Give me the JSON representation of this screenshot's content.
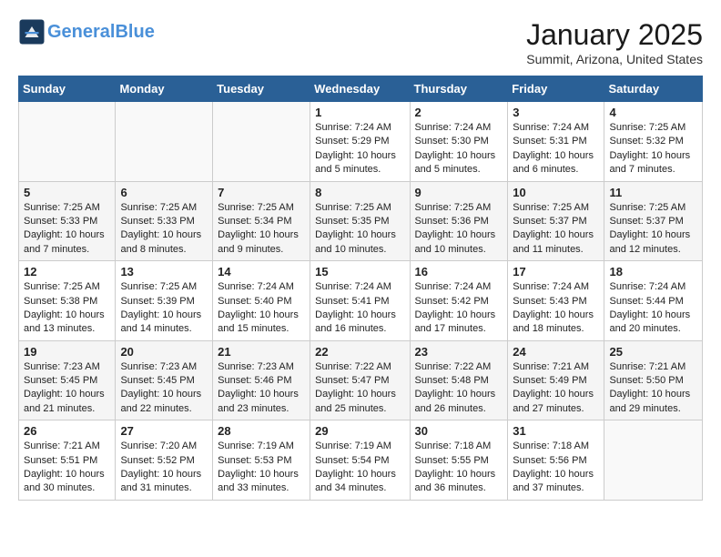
{
  "header": {
    "logo_line1": "General",
    "logo_line2": "Blue",
    "month": "January 2025",
    "location": "Summit, Arizona, United States"
  },
  "days_of_week": [
    "Sunday",
    "Monday",
    "Tuesday",
    "Wednesday",
    "Thursday",
    "Friday",
    "Saturday"
  ],
  "weeks": [
    [
      {
        "day": "",
        "content": ""
      },
      {
        "day": "",
        "content": ""
      },
      {
        "day": "",
        "content": ""
      },
      {
        "day": "1",
        "content": "Sunrise: 7:24 AM\nSunset: 5:29 PM\nDaylight: 10 hours\nand 5 minutes."
      },
      {
        "day": "2",
        "content": "Sunrise: 7:24 AM\nSunset: 5:30 PM\nDaylight: 10 hours\nand 5 minutes."
      },
      {
        "day": "3",
        "content": "Sunrise: 7:24 AM\nSunset: 5:31 PM\nDaylight: 10 hours\nand 6 minutes."
      },
      {
        "day": "4",
        "content": "Sunrise: 7:25 AM\nSunset: 5:32 PM\nDaylight: 10 hours\nand 7 minutes."
      }
    ],
    [
      {
        "day": "5",
        "content": "Sunrise: 7:25 AM\nSunset: 5:33 PM\nDaylight: 10 hours\nand 7 minutes."
      },
      {
        "day": "6",
        "content": "Sunrise: 7:25 AM\nSunset: 5:33 PM\nDaylight: 10 hours\nand 8 minutes."
      },
      {
        "day": "7",
        "content": "Sunrise: 7:25 AM\nSunset: 5:34 PM\nDaylight: 10 hours\nand 9 minutes."
      },
      {
        "day": "8",
        "content": "Sunrise: 7:25 AM\nSunset: 5:35 PM\nDaylight: 10 hours\nand 10 minutes."
      },
      {
        "day": "9",
        "content": "Sunrise: 7:25 AM\nSunset: 5:36 PM\nDaylight: 10 hours\nand 10 minutes."
      },
      {
        "day": "10",
        "content": "Sunrise: 7:25 AM\nSunset: 5:37 PM\nDaylight: 10 hours\nand 11 minutes."
      },
      {
        "day": "11",
        "content": "Sunrise: 7:25 AM\nSunset: 5:37 PM\nDaylight: 10 hours\nand 12 minutes."
      }
    ],
    [
      {
        "day": "12",
        "content": "Sunrise: 7:25 AM\nSunset: 5:38 PM\nDaylight: 10 hours\nand 13 minutes."
      },
      {
        "day": "13",
        "content": "Sunrise: 7:25 AM\nSunset: 5:39 PM\nDaylight: 10 hours\nand 14 minutes."
      },
      {
        "day": "14",
        "content": "Sunrise: 7:24 AM\nSunset: 5:40 PM\nDaylight: 10 hours\nand 15 minutes."
      },
      {
        "day": "15",
        "content": "Sunrise: 7:24 AM\nSunset: 5:41 PM\nDaylight: 10 hours\nand 16 minutes."
      },
      {
        "day": "16",
        "content": "Sunrise: 7:24 AM\nSunset: 5:42 PM\nDaylight: 10 hours\nand 17 minutes."
      },
      {
        "day": "17",
        "content": "Sunrise: 7:24 AM\nSunset: 5:43 PM\nDaylight: 10 hours\nand 18 minutes."
      },
      {
        "day": "18",
        "content": "Sunrise: 7:24 AM\nSunset: 5:44 PM\nDaylight: 10 hours\nand 20 minutes."
      }
    ],
    [
      {
        "day": "19",
        "content": "Sunrise: 7:23 AM\nSunset: 5:45 PM\nDaylight: 10 hours\nand 21 minutes."
      },
      {
        "day": "20",
        "content": "Sunrise: 7:23 AM\nSunset: 5:45 PM\nDaylight: 10 hours\nand 22 minutes."
      },
      {
        "day": "21",
        "content": "Sunrise: 7:23 AM\nSunset: 5:46 PM\nDaylight: 10 hours\nand 23 minutes."
      },
      {
        "day": "22",
        "content": "Sunrise: 7:22 AM\nSunset: 5:47 PM\nDaylight: 10 hours\nand 25 minutes."
      },
      {
        "day": "23",
        "content": "Sunrise: 7:22 AM\nSunset: 5:48 PM\nDaylight: 10 hours\nand 26 minutes."
      },
      {
        "day": "24",
        "content": "Sunrise: 7:21 AM\nSunset: 5:49 PM\nDaylight: 10 hours\nand 27 minutes."
      },
      {
        "day": "25",
        "content": "Sunrise: 7:21 AM\nSunset: 5:50 PM\nDaylight: 10 hours\nand 29 minutes."
      }
    ],
    [
      {
        "day": "26",
        "content": "Sunrise: 7:21 AM\nSunset: 5:51 PM\nDaylight: 10 hours\nand 30 minutes."
      },
      {
        "day": "27",
        "content": "Sunrise: 7:20 AM\nSunset: 5:52 PM\nDaylight: 10 hours\nand 31 minutes."
      },
      {
        "day": "28",
        "content": "Sunrise: 7:19 AM\nSunset: 5:53 PM\nDaylight: 10 hours\nand 33 minutes."
      },
      {
        "day": "29",
        "content": "Sunrise: 7:19 AM\nSunset: 5:54 PM\nDaylight: 10 hours\nand 34 minutes."
      },
      {
        "day": "30",
        "content": "Sunrise: 7:18 AM\nSunset: 5:55 PM\nDaylight: 10 hours\nand 36 minutes."
      },
      {
        "day": "31",
        "content": "Sunrise: 7:18 AM\nSunset: 5:56 PM\nDaylight: 10 hours\nand 37 minutes."
      },
      {
        "day": "",
        "content": ""
      }
    ]
  ]
}
